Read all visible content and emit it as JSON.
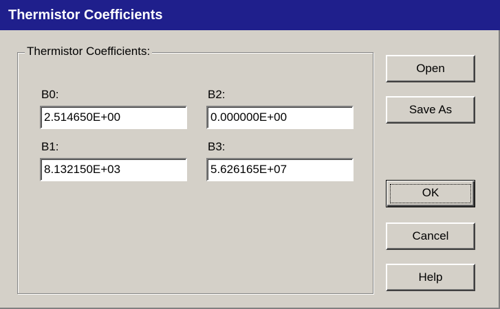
{
  "window": {
    "title": "Thermistor Coefficients"
  },
  "group": {
    "legend": "Thermistor Coefficients:"
  },
  "fields": {
    "b0": {
      "label": "B0:",
      "value": "2.514650E+00"
    },
    "b1": {
      "label": "B1:",
      "value": "8.132150E+03"
    },
    "b2": {
      "label": "B2:",
      "value": "0.000000E+00"
    },
    "b3": {
      "label": "B3:",
      "value": "5.626165E+07"
    }
  },
  "buttons": {
    "open": "Open",
    "save_as": "Save As",
    "ok": "OK",
    "cancel": "Cancel",
    "help": "Help"
  },
  "colors": {
    "titlebar": "#1f1f8c",
    "face": "#d4d0c8"
  }
}
